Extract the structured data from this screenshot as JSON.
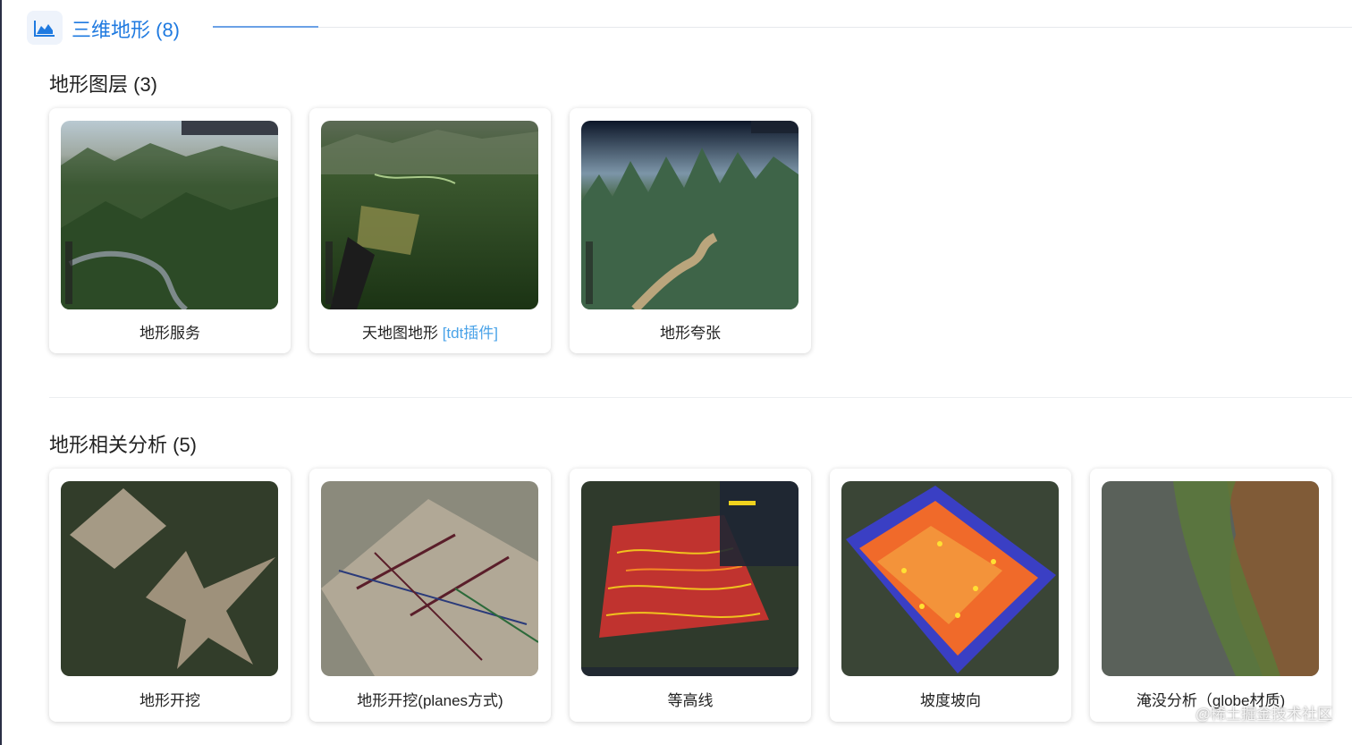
{
  "section": {
    "title": "三维地形 (8)",
    "icon": "area-chart-icon"
  },
  "groups": [
    {
      "title": "地形图层 (3)",
      "cards": [
        {
          "label": "地形服务",
          "tag": ""
        },
        {
          "label": "天地图地形",
          "tag": "[tdt插件]"
        },
        {
          "label": "地形夸张",
          "tag": ""
        }
      ]
    },
    {
      "title": "地形相关分析 (5)",
      "cards": [
        {
          "label": "地形开挖",
          "tag": ""
        },
        {
          "label": "地形开挖(planes方式)",
          "tag": ""
        },
        {
          "label": "等高线",
          "tag": ""
        },
        {
          "label": "坡度坡向",
          "tag": ""
        },
        {
          "label": "淹没分析（globe材质)",
          "tag": ""
        }
      ]
    }
  ],
  "watermark": "@稀土掘金技术社区",
  "colors": {
    "accent": "#1f7ae0",
    "tag": "#4aa3e8"
  }
}
